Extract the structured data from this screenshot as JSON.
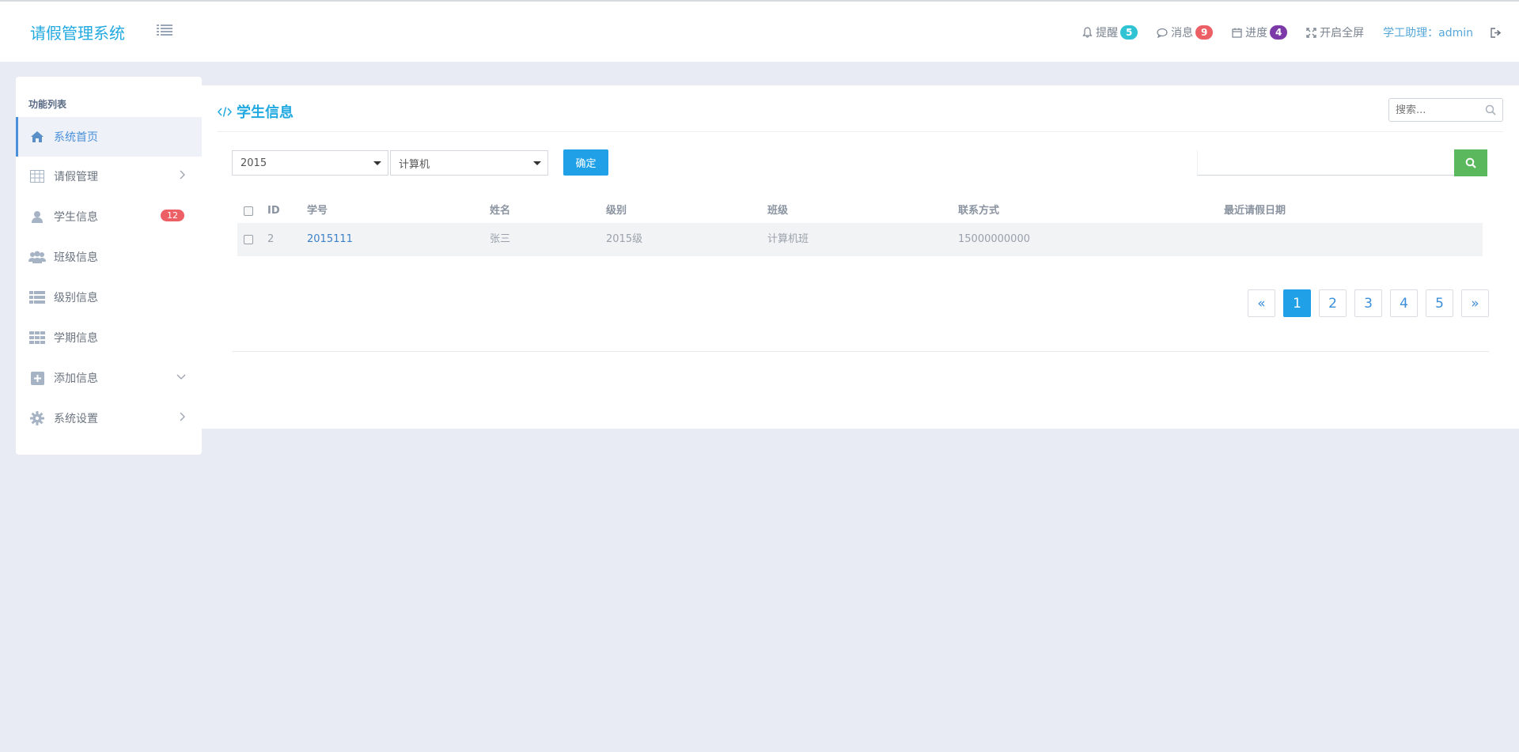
{
  "app": {
    "brand": "请假管理系统"
  },
  "header": {
    "reminder_label": "提醒",
    "reminder_count": "5",
    "message_label": "消息",
    "message_count": "9",
    "progress_label": "进度",
    "progress_count": "4",
    "fullscreen_label": "开启全屏",
    "user_label": "学工助理：admin",
    "colors": {
      "reminder": "#2fc3d3",
      "message": "#ec6065",
      "progress": "#7c3aa8"
    }
  },
  "sidebar": {
    "title": "功能列表",
    "items": [
      {
        "label": "系统首页",
        "icon": "home-icon"
      },
      {
        "label": "请假管理",
        "icon": "table-icon"
      },
      {
        "label": "学生信息",
        "icon": "user-icon",
        "badge": "12"
      },
      {
        "label": "班级信息",
        "icon": "users-icon"
      },
      {
        "label": "级别信息",
        "icon": "list-icon"
      },
      {
        "label": "学期信息",
        "icon": "grid-icon"
      },
      {
        "label": "添加信息",
        "icon": "plus-square-icon"
      },
      {
        "label": "系统设置",
        "icon": "gear-icon"
      }
    ]
  },
  "main": {
    "title": "学生信息",
    "search_placeholder": "搜索...",
    "year_select": "2015",
    "major_select": "计算机",
    "confirm_label": "确定",
    "table": {
      "headers": [
        "ID",
        "学号",
        "姓名",
        "级别",
        "班级",
        "联系方式",
        "最近请假日期"
      ],
      "rows": [
        {
          "id": "2",
          "student_no": "2015111",
          "name": "张三",
          "level": "2015级",
          "class": "计算机班",
          "contact": "15000000000",
          "last_leave": ""
        }
      ]
    },
    "pagination": [
      "«",
      "1",
      "2",
      "3",
      "4",
      "5",
      "»"
    ],
    "active_page": "1"
  }
}
